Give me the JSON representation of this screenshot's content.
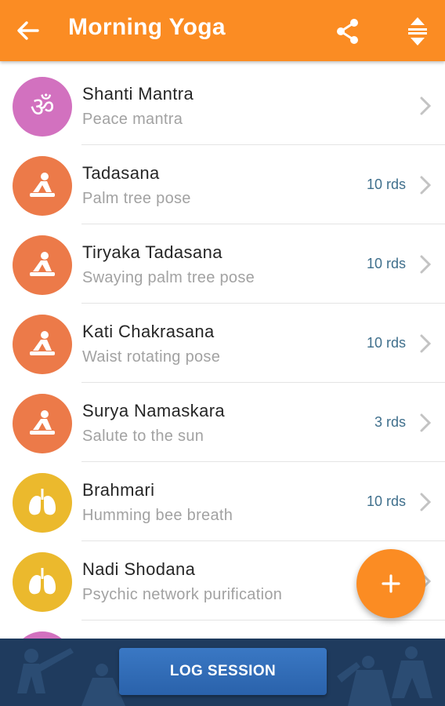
{
  "header": {
    "title": "Morning Yoga",
    "back_icon": "arrow-back-icon",
    "share_icon": "share-icon",
    "sort_icon": "sort-arrows-icon",
    "bg_color": "#fb8c23"
  },
  "items": [
    {
      "name": "Shanti Mantra",
      "subtitle": "Peace mantra",
      "rounds": "",
      "icon": "om-icon",
      "color": "#d271bf"
    },
    {
      "name": "Tadasana",
      "subtitle": "Palm tree pose",
      "rounds": "10 rds",
      "icon": "meditation-pose-icon",
      "color": "#ec7a49"
    },
    {
      "name": "Tiryaka Tadasana",
      "subtitle": "Swaying palm tree pose",
      "rounds": "10 rds",
      "icon": "meditation-pose-icon",
      "color": "#ec7a49"
    },
    {
      "name": "Kati Chakrasana",
      "subtitle": "Waist rotating pose",
      "rounds": "10 rds",
      "icon": "meditation-pose-icon",
      "color": "#ec7a49"
    },
    {
      "name": "Surya Namaskara",
      "subtitle": "Salute to the sun",
      "rounds": "3 rds",
      "icon": "meditation-pose-icon",
      "color": "#ec7a49"
    },
    {
      "name": "Brahmari",
      "subtitle": "Humming bee breath",
      "rounds": "10 rds",
      "icon": "lungs-icon",
      "color": "#ebb92d"
    },
    {
      "name": "Nadi Shodana",
      "subtitle": "Psychic network purification",
      "rounds": "",
      "icon": "lungs-icon",
      "color": "#ebb92d"
    },
    {
      "name": "",
      "subtitle": "",
      "rounds": "",
      "icon": "om-icon",
      "color": "#d271bf"
    }
  ],
  "fab": {
    "icon": "plus-icon",
    "color": "#fb8c23"
  },
  "bottom": {
    "log_label": "LOG SESSION",
    "bar_color": "#1f3b5e",
    "button_color": "#2f6cb6"
  }
}
